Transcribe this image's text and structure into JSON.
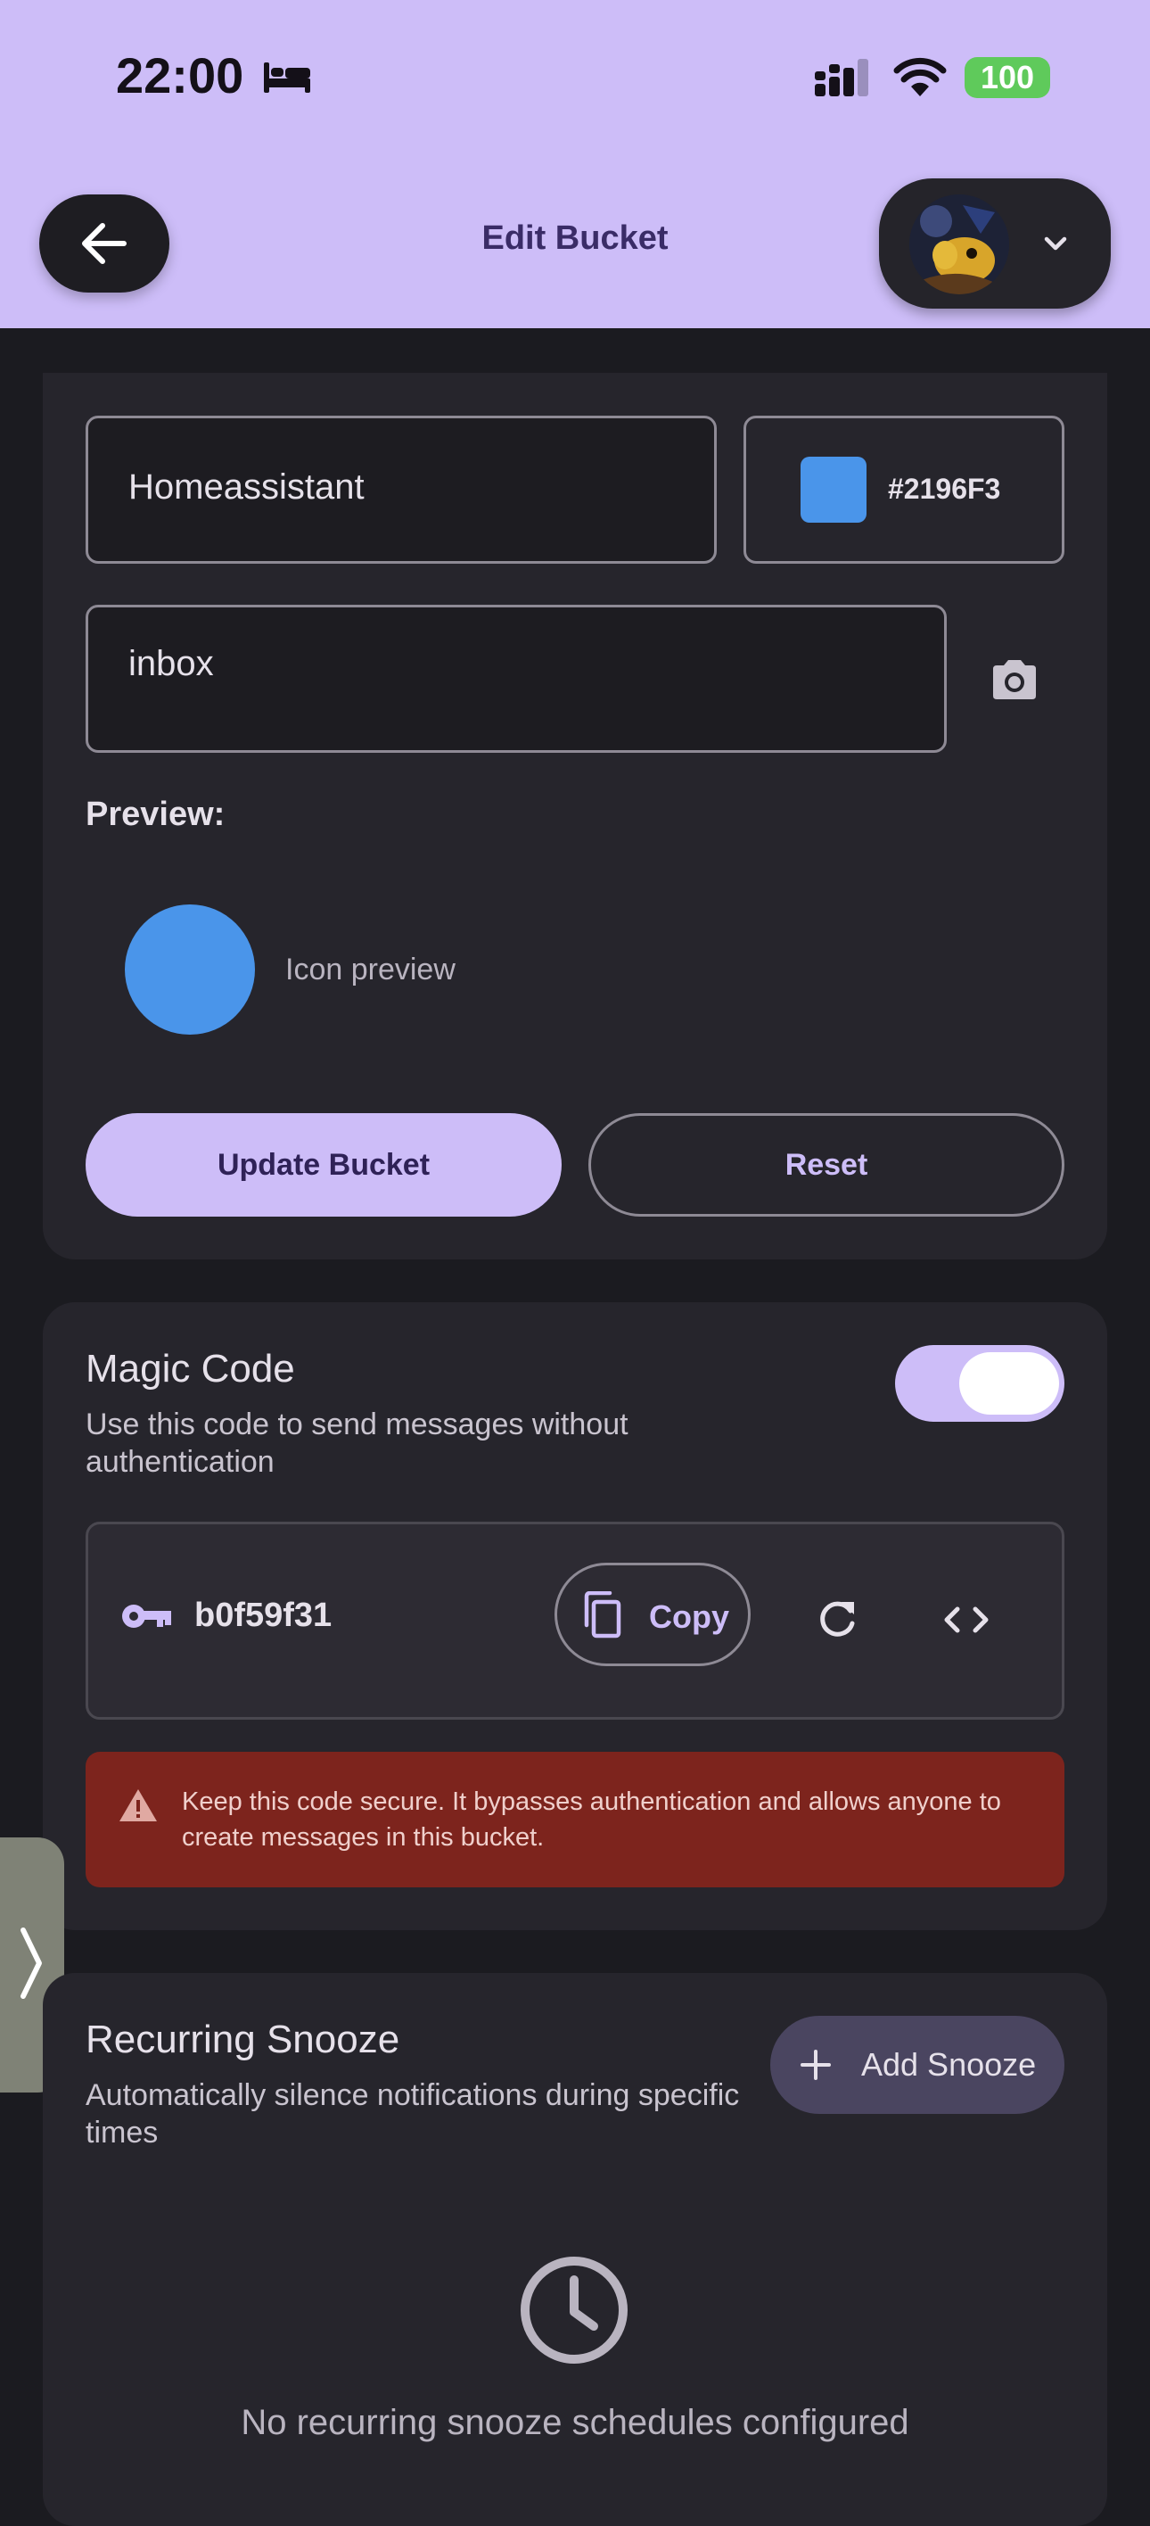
{
  "status_bar": {
    "time": "22:00",
    "battery": "100"
  },
  "header": {
    "title": "Edit Bucket"
  },
  "edit_form": {
    "name_value": "Homeassistant",
    "color_value": "#2196F3",
    "icon_value": "inbox",
    "preview_label": "Preview:",
    "preview_text": "Icon preview",
    "update_label": "Update Bucket",
    "reset_label": "Reset"
  },
  "magic_code": {
    "title": "Magic Code",
    "description": "Use this code to send messages without authentication",
    "enabled": true,
    "code": "b0f59f31",
    "copy_label": "Copy",
    "warning": "Keep this code secure. It bypasses authentication and allows anyone to create messages in this bucket."
  },
  "recurring_snooze": {
    "title": "Recurring Snooze",
    "description": "Automatically silence notifications during specific times",
    "add_label": "Add Snooze",
    "empty_text": "No recurring snooze schedules configured"
  },
  "colors": {
    "header_bg": "#cdbdf8",
    "accent": "#cdbdf8",
    "bucket_color": "#2196F3",
    "warning_bg": "#7d241d",
    "battery": "#5fca5b"
  },
  "icons": [
    "bed-icon",
    "signal-icon",
    "wifi-icon",
    "back-arrow-icon",
    "chevron-down-icon",
    "camera-icon",
    "key-icon",
    "copy-icon",
    "refresh-icon",
    "code-icon",
    "warning-icon",
    "chevron-right-icon",
    "plus-icon",
    "clock-icon"
  ]
}
